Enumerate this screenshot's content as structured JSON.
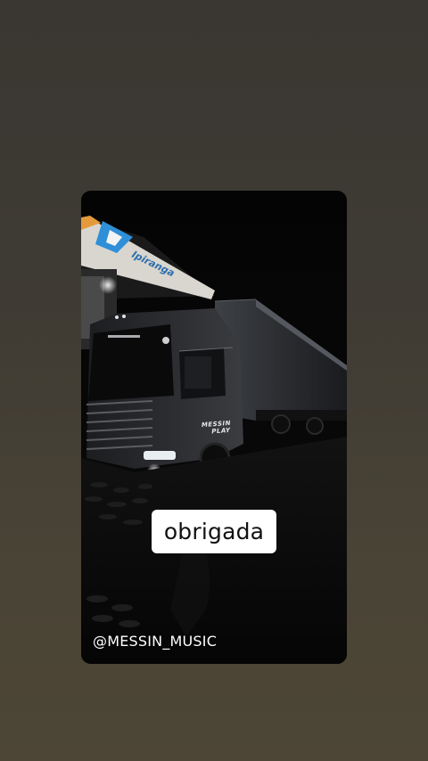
{
  "story": {
    "watermark_line1": "MESSIN",
    "watermark_line2": "PLAY",
    "caption": "obrigada",
    "handle": "@MESSIN_MUSIC",
    "station_sign": "Ipiranga"
  },
  "colors": {
    "page_background": "#3f3b34",
    "card_background": "#070707",
    "caption_background": "#ffffff",
    "caption_text": "#111111",
    "handle_text": "#ffffff",
    "canopy_accent": "#e59a3a",
    "sign_blue": "#2f8fd8"
  }
}
